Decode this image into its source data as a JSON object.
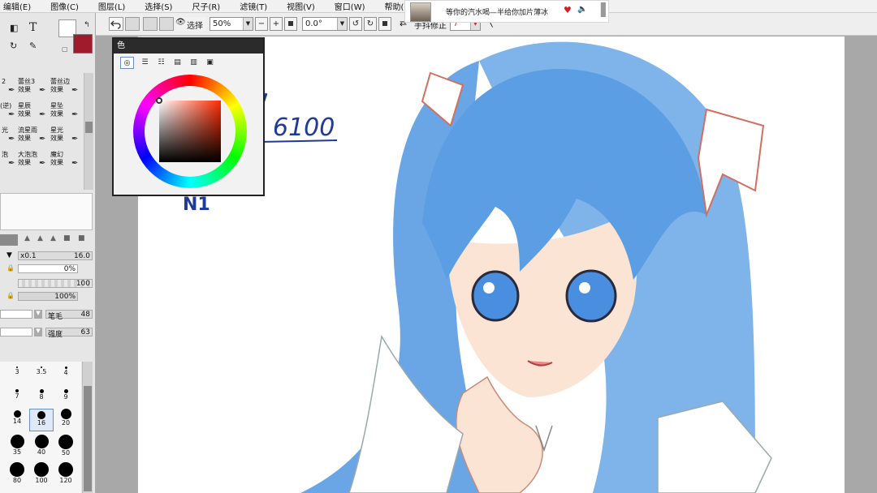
{
  "menu": [
    "编辑(E)",
    "图像(C)",
    "图层(L)",
    "选择(S)",
    "尺子(R)",
    "滤镜(T)",
    "视图(V)",
    "窗口(W)",
    "帮助(H)"
  ],
  "toolbar": {
    "select_label": "选择",
    "zoom_value": "50%",
    "minus_label": "−",
    "plus_label": "+",
    "rotation_value": "0.0°",
    "stabilizer_label": "手抖修正",
    "stabilizer_value": "7"
  },
  "notification": {
    "text": "等你的汽水喝—半给你加片薄冰"
  },
  "color_panel": {
    "title": "色",
    "primary_color": "#ffffff",
    "secondary_color": "#a01b2b",
    "picker_hue": "#ff2a00"
  },
  "brushes": {
    "rows": [
      [
        "2",
        "蕾丝3\n效果",
        "蕾丝边\n效果"
      ],
      [
        "(逆)",
        "星辰\n效果",
        "星坠\n效果"
      ],
      [
        "光",
        "流星雨\n效果",
        "星光\n效果"
      ],
      [
        "泡",
        "大泡泡\n效果",
        "魔幻\n效果"
      ]
    ]
  },
  "properties": {
    "size_multiplier": "x0.1",
    "size_value": "16.0",
    "min_size": "0%",
    "density": "100",
    "opacity": "100%",
    "bristle_label": "笔毛",
    "bristle_value": "48",
    "strength_label": "强度",
    "strength_value": "63"
  },
  "brush_sizes": {
    "labels": [
      "3",
      "3.5",
      "4",
      "7",
      "8",
      "9",
      "14",
      "16",
      "20",
      "35",
      "40",
      "50",
      "80",
      "100",
      "120"
    ],
    "selected": "16"
  },
  "canvas_text": {
    "number": "6100",
    "note": "N1"
  }
}
